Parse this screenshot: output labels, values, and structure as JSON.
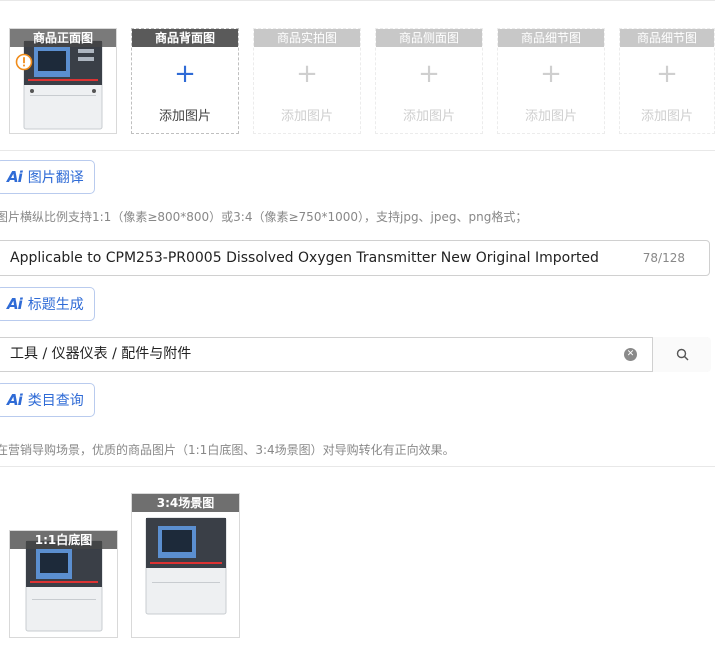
{
  "image_slots": [
    {
      "label": "商品正面图",
      "state": "filled"
    },
    {
      "label": "商品背面图",
      "state": "active",
      "add_text": "添加图片"
    },
    {
      "label": "商品实拍图",
      "state": "disabled",
      "add_text": "添加图片"
    },
    {
      "label": "商品侧面图",
      "state": "disabled",
      "add_text": "添加图片"
    },
    {
      "label": "商品细节图",
      "state": "disabled",
      "add_text": "添加图片"
    },
    {
      "label": "商品细节图",
      "state": "disabled",
      "add_text": "添加图片"
    }
  ],
  "plus_glyph": "+",
  "ai_translate": {
    "icon": "Ai",
    "label": "图片翻译"
  },
  "image_hint": "图片横纵比例支持1:1（像素≥800*800）或3:4（像素≥750*1000），支持jpg、jpeg、png格式；",
  "title_field": {
    "value": "Applicable to CPM253-PR0005 Dissolved Oxygen Transmitter New Original Imported",
    "counter": "78/128"
  },
  "ai_title": {
    "icon": "Ai",
    "label": "标题生成"
  },
  "category_field": {
    "value": "工具 / 仪器仪表 / 配件与附件"
  },
  "ai_category": {
    "icon": "Ai",
    "label": "类目查询"
  },
  "marketing_hint": "在营销导购场景，优质的商品图片（1:1白底图、3:4场景图）对导购转化有正向效果。",
  "marketing_slots": [
    {
      "label": "1:1白底图"
    },
    {
      "label": "3:4场景图"
    }
  ],
  "colors": {
    "accent": "#2f6bd6",
    "warning": "#f08c1a",
    "border": "#d0d0d0"
  }
}
